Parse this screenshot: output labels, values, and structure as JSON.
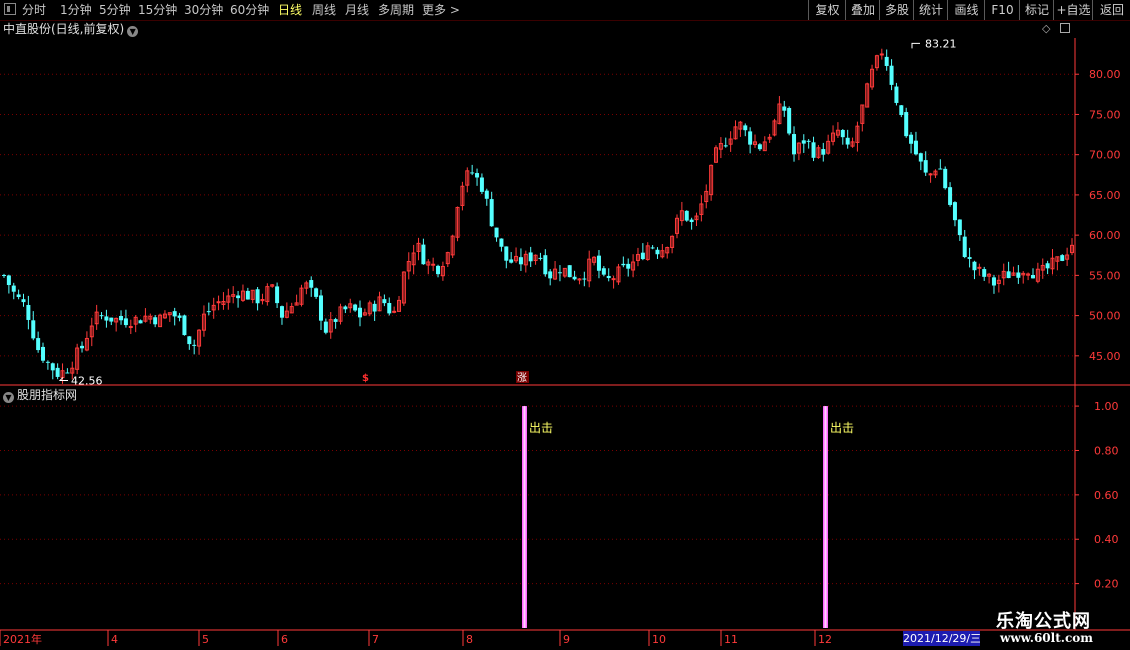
{
  "toolbar": {
    "periods": [
      "分时",
      "1分钟",
      "5分钟",
      "15分钟",
      "30分钟",
      "60分钟",
      "日线",
      "周线",
      "月线",
      "多周期",
      "更多 >"
    ],
    "active_period": "日线",
    "actions": [
      "复权",
      "叠加",
      "多股",
      "统计",
      "画线",
      "F10",
      "标记",
      "+自选",
      "返回"
    ]
  },
  "main_chart": {
    "title": "中直股份(日线,前复权)",
    "high_label": "83.21",
    "low_label": "42.56",
    "marker_dollar": "$",
    "marker_zhang": "涨"
  },
  "indicator": {
    "title": "股朋指标网",
    "signal_label": "出击"
  },
  "date_bar": {
    "year_label": "2021年",
    "months": [
      "4",
      "5",
      "6",
      "7",
      "8",
      "9",
      "10",
      "11",
      "12"
    ],
    "current_date": "2021/12/29/三"
  },
  "watermark": {
    "line1": "乐淘公式网",
    "line2": "www.60lt.com"
  },
  "colors": {
    "up": "#ff3a3a",
    "down": "#54ffff",
    "grid": "#7a0000",
    "axis": "#ff3a3a",
    "signal": "#ff66ff",
    "signal_text": "#ffff66"
  },
  "chart_data": [
    {
      "type": "candlestick",
      "title": "中直股份(日线,前复权)",
      "ylim": [
        41.5,
        84.5
      ],
      "yticks": [
        "45.00",
        "50.00",
        "55.00",
        "60.00",
        "65.00",
        "70.00",
        "75.00",
        "80.00"
      ],
      "y_tick_values": [
        45,
        50,
        55,
        60,
        65,
        70,
        75,
        80
      ],
      "months": [
        "2021年",
        "4",
        "5",
        "6",
        "7",
        "8",
        "9",
        "10",
        "11",
        "12"
      ],
      "close_path": [
        55,
        52.5,
        51,
        46,
        44,
        42.6,
        44,
        46,
        49.5,
        50,
        49.5,
        49.5,
        49.5,
        50,
        49.5,
        50.5,
        49,
        46,
        50,
        51.5,
        52,
        53,
        52.5,
        52,
        53.5,
        50,
        51.5,
        54,
        52,
        48,
        50,
        51,
        50,
        51,
        52,
        50,
        55.5,
        59,
        56.5,
        56,
        58,
        66,
        68,
        66,
        61,
        57,
        56.5,
        57,
        58,
        55,
        56,
        55,
        55,
        57,
        54,
        55,
        56,
        57,
        59,
        58,
        60,
        63,
        61,
        65,
        70,
        72,
        74,
        72,
        71,
        73,
        76.5,
        70,
        72,
        70,
        71,
        73,
        70,
        75,
        80,
        83.2,
        78,
        73,
        70,
        67,
        69,
        64,
        59,
        56,
        55,
        54,
        55,
        55.5,
        56,
        55,
        56,
        57,
        59
      ],
      "candles": 220,
      "high": 83.21,
      "low": 42.56
    },
    {
      "type": "bar",
      "title": "股朋指标网",
      "ylim": [
        0,
        1.05
      ],
      "yticks": [
        "0.20",
        "0.40",
        "0.60",
        "0.80",
        "1.00"
      ],
      "y_tick_values": [
        0.2,
        0.4,
        0.6,
        0.8,
        1.0
      ],
      "signals": [
        {
          "label": "出击",
          "value": 1.0,
          "month_position": "between 8 and 9"
        },
        {
          "label": "出击",
          "value": 1.0,
          "month_position": "near 12"
        }
      ]
    }
  ]
}
